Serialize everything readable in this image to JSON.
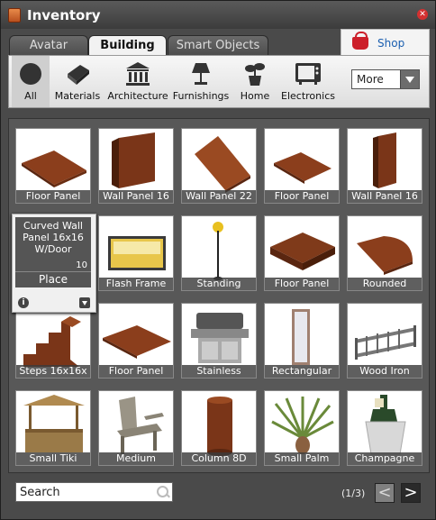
{
  "window": {
    "title": "Inventory"
  },
  "tabs": [
    {
      "label": "Avatar",
      "active": false
    },
    {
      "label": "Building",
      "active": true
    },
    {
      "label": "Smart Objects",
      "active": false
    }
  ],
  "shop": {
    "label": "Shop",
    "icon": "basket-icon"
  },
  "categories": [
    {
      "label": "All",
      "icon": "circle-icon",
      "active": true
    },
    {
      "label": "Materials",
      "icon": "bricks-icon"
    },
    {
      "label": "Architecture",
      "icon": "columns-icon"
    },
    {
      "label": "Furnishings",
      "icon": "lamp-icon"
    },
    {
      "label": "Home",
      "icon": "plant-icon"
    },
    {
      "label": "Electronics",
      "icon": "tv-icon"
    }
  ],
  "more_dropdown": {
    "value": "More"
  },
  "items": [
    {
      "label": "Floor Panel"
    },
    {
      "label": "Wall Panel 16"
    },
    {
      "label": "Wall Panel 22"
    },
    {
      "label": "Floor Panel"
    },
    {
      "label": "Wall Panel 16"
    },
    {
      "label": "Flash Frame"
    },
    {
      "label": "Standing"
    },
    {
      "label": "Floor Panel"
    },
    {
      "label": "Rounded"
    },
    {
      "label": "Steps 16x16x"
    },
    {
      "label": "Floor Panel"
    },
    {
      "label": "Stainless"
    },
    {
      "label": "Rectangular"
    },
    {
      "label": "Wood Iron"
    },
    {
      "label": "Small Tiki"
    },
    {
      "label": "Medium"
    },
    {
      "label": "Column 8D"
    },
    {
      "label": "Small Palm"
    },
    {
      "label": "Champagne"
    }
  ],
  "popup": {
    "title": "Curved Wall Panel 16x16 W/Door",
    "count": "10",
    "action": "Place"
  },
  "search": {
    "value": "Search"
  },
  "pagination": {
    "indicator": "(1/3)",
    "prev": "<",
    "next": ">"
  },
  "colors": {
    "wood": "#8b3e1c",
    "window_bg": "#4a4a4a",
    "accent_link": "#1b5fb0"
  }
}
